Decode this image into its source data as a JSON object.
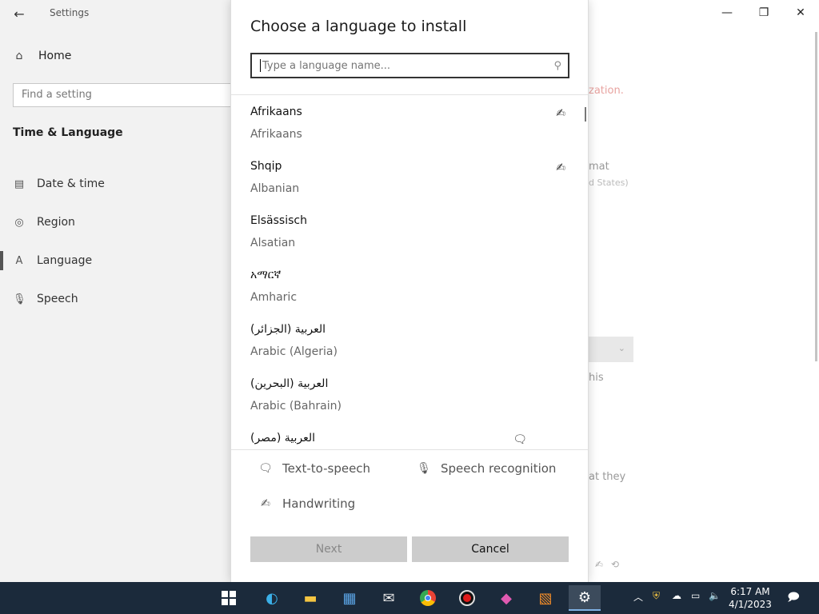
{
  "settings": {
    "title": "Settings",
    "home": "Home",
    "search_placeholder": "Find a setting",
    "section": "Time & Language",
    "nav": [
      {
        "label": "Date & time",
        "icon": "clock-icon",
        "glyph": "▤"
      },
      {
        "label": "Region",
        "icon": "globe-icon",
        "glyph": "◎"
      },
      {
        "label": "Language",
        "icon": "language-icon",
        "glyph": "A"
      },
      {
        "label": "Speech",
        "icon": "microphone-icon",
        "glyph": "🎙"
      }
    ],
    "active_nav": "Language",
    "bg_text": {
      "warning": "zation.",
      "format": "mat",
      "format_sub": "d States)",
      "this": "his",
      "that_they": "at they"
    },
    "accent_warning": "#d9534f"
  },
  "dialog": {
    "title": "Choose a language to install",
    "search_placeholder": "Type a language name...",
    "languages": [
      {
        "native": "Afrikaans",
        "english": "Afrikaans",
        "feature": "handwriting-icon",
        "glyph": "✍"
      },
      {
        "native": "Shqip",
        "english": "Albanian",
        "feature": "handwriting-icon",
        "glyph": "✍"
      },
      {
        "native": "Elsässisch",
        "english": "Alsatian",
        "feature": "",
        "glyph": ""
      },
      {
        "native": "አማርኛ",
        "english": "Amharic",
        "feature": "",
        "glyph": ""
      },
      {
        "native": "العربية (الجزائر)",
        "english": "Arabic (Algeria)",
        "feature": "",
        "glyph": ""
      },
      {
        "native": "العربية (البحرين)",
        "english": "Arabic (Bahrain)",
        "feature": "",
        "glyph": ""
      },
      {
        "native": "العربية (مصر)",
        "english": "",
        "feature": "text-to-speech-icon",
        "glyph": "🗨"
      }
    ],
    "legend": {
      "tts": "Text-to-speech",
      "speech": "Speech recognition",
      "handwriting": "Handwriting"
    },
    "buttons": {
      "next": "Next",
      "cancel": "Cancel"
    }
  },
  "taskbar": {
    "time": "6:17 AM",
    "date": "4/1/2023",
    "apps": [
      "start-icon",
      "edge-icon",
      "file-explorer-icon",
      "store-icon",
      "mail-icon",
      "chrome-icon",
      "recorder-icon",
      "maps-icon",
      "office-icon",
      "settings-icon"
    ]
  }
}
